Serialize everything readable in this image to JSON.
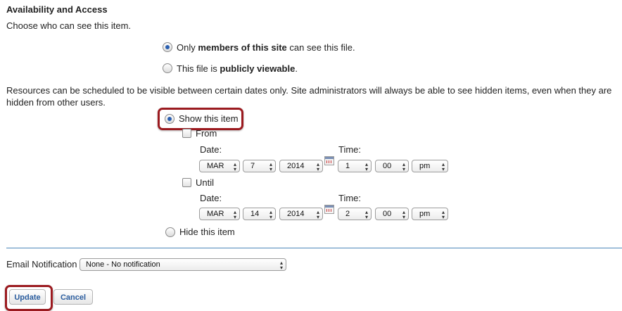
{
  "section": {
    "title": "Availability and Access",
    "intro": "Choose who can see this item."
  },
  "access": {
    "members_prefix": "Only ",
    "members_bold": "members of this site",
    "members_suffix": " can see this file.",
    "public_prefix": "This file is ",
    "public_bold": "publicly viewable",
    "public_suffix": "."
  },
  "schedule": {
    "description": "Resources can be scheduled to be visible between certain dates only. Site administrators will always be able to see hidden items, even when they are hidden from other users.",
    "show_label": "Show this item",
    "hide_label": "Hide this item",
    "from": {
      "label": "From",
      "date_label": "Date:",
      "time_label": "Time:",
      "month": "MAR",
      "day": "7",
      "year": "2014",
      "hour": "1",
      "minute": "00",
      "ampm": "pm"
    },
    "until": {
      "label": "Until",
      "date_label": "Date:",
      "time_label": "Time:",
      "month": "MAR",
      "day": "14",
      "year": "2014",
      "hour": "2",
      "minute": "00",
      "ampm": "pm"
    }
  },
  "email": {
    "label": "Email Notification",
    "selected": "None - No notification"
  },
  "buttons": {
    "update": "Update",
    "cancel": "Cancel"
  },
  "colors": {
    "highlight": "#9b1a1f",
    "divider": "#4a86b8",
    "button_text": "#2a5d9f"
  }
}
